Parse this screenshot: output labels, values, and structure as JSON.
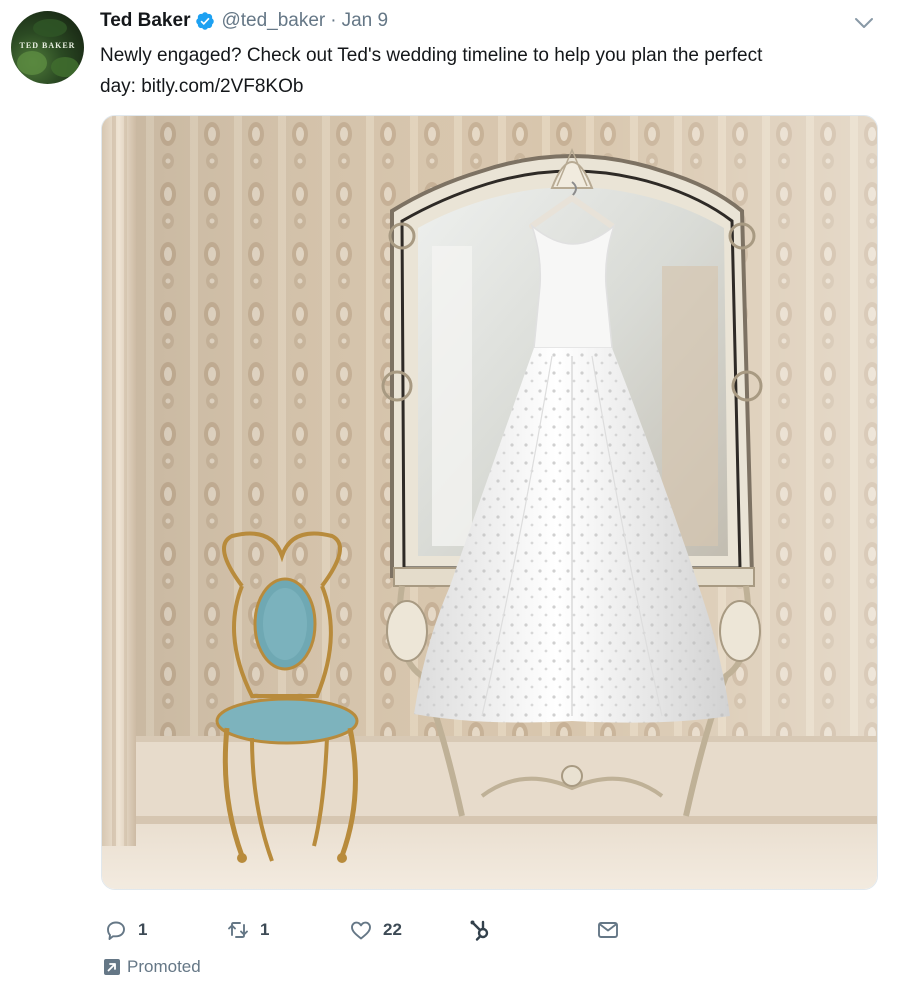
{
  "tweet": {
    "author_name": "Ted Baker",
    "handle": "@ted_baker",
    "separator": "·",
    "date": "Jan 9",
    "text_line1": "Newly engaged? Check out Ted's wedding timeline to help you plan the perfect",
    "text_line2": "day: bitly.com/2VF8KOb",
    "avatar_text": "TED BAKER",
    "media_icon": "wedding-dress-photo"
  },
  "actions": {
    "reply_count": "1",
    "retweet_count": "1",
    "like_count": "22"
  },
  "promoted_label": "Promoted",
  "colors": {
    "verified": "#1da1f2",
    "secondary_text": "#657786",
    "primary_text": "#14171a"
  }
}
